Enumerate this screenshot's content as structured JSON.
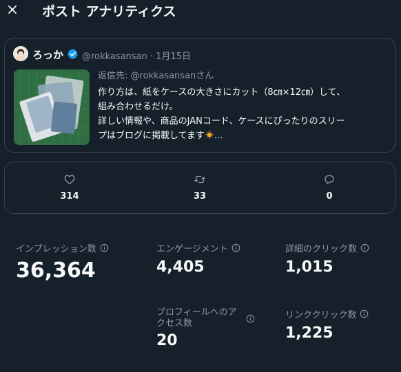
{
  "header": {
    "title": "ポスト アナリティクス",
    "close_icon": "close-icon"
  },
  "tweet": {
    "author_name": "ろっか",
    "verified": true,
    "handle": "@rokkasansan",
    "separator": "·",
    "date": "1月15日",
    "reply_prefix": "返信先: ",
    "reply_handle": "@rokkasansan",
    "reply_suffix": "さん",
    "text_lines": [
      "作り方は、紙をケースの大きさにカット（8㎝×12㎝）して、",
      "組み合わせるだけ。",
      "詳しい情報や、商品のJANコード、ケースにぴったりのスリー",
      "プはブログに掲載してます"
    ],
    "text_ellipsis": "..."
  },
  "engagement": {
    "likes": "314",
    "retweets": "33",
    "replies": "0"
  },
  "metrics": {
    "impressions": {
      "label": "インプレッション数",
      "value": "36,364"
    },
    "engagements": {
      "label": "エンゲージメント",
      "value": "4,405"
    },
    "detail_clicks": {
      "label": "詳細のクリック数",
      "value": "1,015"
    },
    "profile_visits": {
      "label_line1": "プロフィールへのア",
      "label_line2": "クセス数",
      "value": "20"
    },
    "link_clicks": {
      "label": "リンククリック数",
      "value": "1,225"
    }
  },
  "colors": {
    "background": "#15202b",
    "border": "#38444d",
    "text_primary": "#f7f9f9",
    "text_secondary": "#8b98a5",
    "verified_blue": "#1d9bf0"
  }
}
